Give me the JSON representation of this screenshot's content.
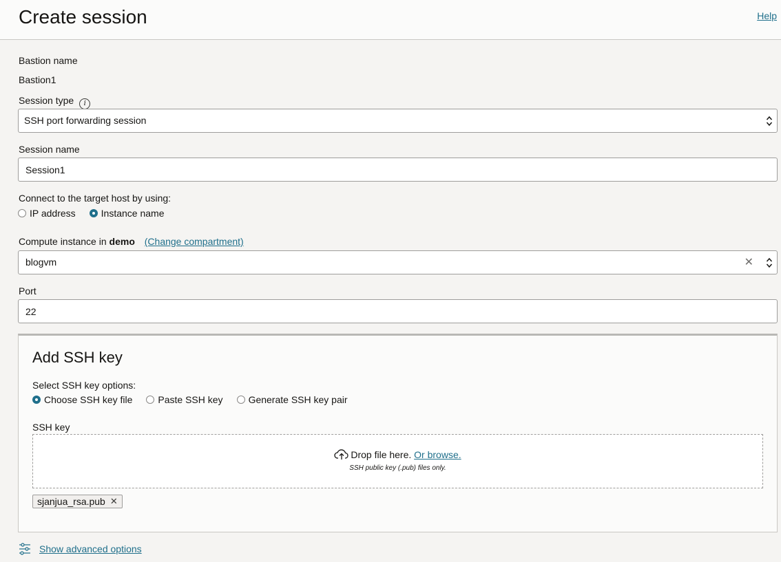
{
  "header": {
    "title": "Create session",
    "help_label": "Help"
  },
  "form": {
    "bastion_name_label": "Bastion name",
    "bastion_name_value": "Bastion1",
    "session_type_label": "Session type",
    "session_type_value": "SSH port forwarding session",
    "session_name_label": "Session name",
    "session_name_value": "Session1",
    "connect_label": "Connect to the target host by using:",
    "connect_options": [
      {
        "label": "IP address",
        "checked": false
      },
      {
        "label": "Instance name",
        "checked": true
      }
    ],
    "compute_label_prefix": "Compute instance in",
    "compute_compartment": "demo",
    "change_compartment_label": "(Change compartment)",
    "compute_value": "blogvm",
    "port_label": "Port",
    "port_value": "22"
  },
  "ssh": {
    "title": "Add SSH key",
    "options_label": "Select SSH key options:",
    "options": [
      {
        "label": "Choose SSH key file",
        "checked": true
      },
      {
        "label": "Paste SSH key",
        "checked": false
      },
      {
        "label": "Generate SSH key pair",
        "checked": false
      }
    ],
    "key_label": "SSH key",
    "drop_text": "Drop file here.",
    "browse_label": "Or browse.",
    "hint": "SSH public key (.pub) files only.",
    "file_name": "sjanjua_rsa.pub"
  },
  "advanced": {
    "label": "Show advanced options"
  },
  "colors": {
    "accent": "#1f6f8b",
    "background": "#f5f4f2"
  }
}
